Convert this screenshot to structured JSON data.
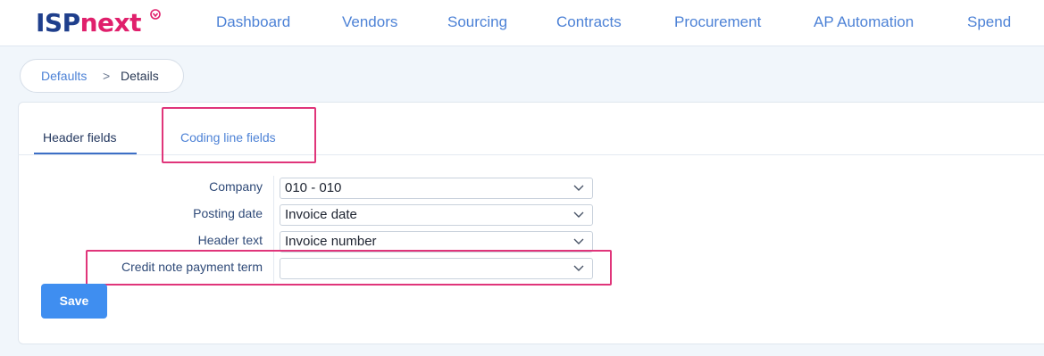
{
  "brand": {
    "logo_part1": "ISP",
    "logo_part2": "next"
  },
  "nav": {
    "items": [
      {
        "label": "Dashboard"
      },
      {
        "label": "Vendors"
      },
      {
        "label": "Sourcing"
      },
      {
        "label": "Contracts"
      },
      {
        "label": "Procurement"
      },
      {
        "label": "AP Automation"
      },
      {
        "label": "Spend"
      }
    ]
  },
  "breadcrumb": {
    "parent": "Defaults",
    "separator": ">",
    "current": "Details"
  },
  "tabs": [
    {
      "label": "Header fields",
      "active": true
    },
    {
      "label": "Coding line fields",
      "active": false
    }
  ],
  "form": {
    "fields": [
      {
        "label": "Company",
        "value": "010 - 010"
      },
      {
        "label": "Posting date",
        "value": "Invoice date"
      },
      {
        "label": "Header text",
        "value": "Invoice number"
      },
      {
        "label": "Credit note payment term",
        "value": ""
      }
    ],
    "save_label": "Save"
  },
  "colors": {
    "accent": "#4d82d6",
    "brand_blue": "#1f3f8c",
    "brand_pink": "#e0206c",
    "highlight": "#e0357a",
    "button": "#3f8ef0"
  }
}
